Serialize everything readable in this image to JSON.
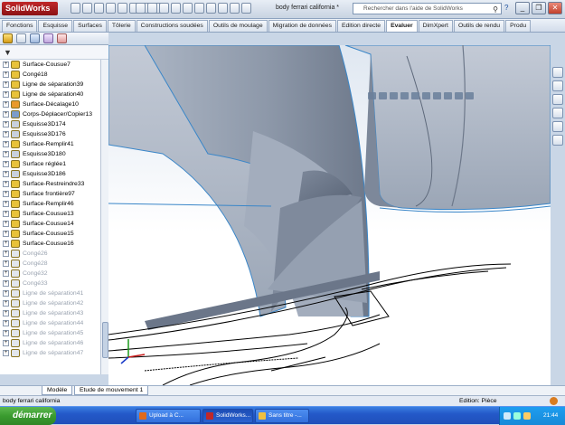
{
  "app": {
    "logo_text": "SolidWorks",
    "document_title": "body ferrari california *"
  },
  "help": {
    "search_placeholder": "Rechercher dans l'aide de SolidWorks",
    "search_icon": "magnifier-icon",
    "help_icon": "question-icon"
  },
  "window_controls": {
    "minimize": "_",
    "restore": "❐",
    "close": "✕"
  },
  "command_tabs": [
    "Fonctions",
    "Esquisse",
    "Surfaces",
    "Tôlerie",
    "Constructions soudées",
    "Outils de moulage",
    "Migration de données",
    "Edition directe",
    "Evaluer",
    "DimXpert",
    "Outils de rendu",
    "Produ"
  ],
  "active_tab": "Evaluer",
  "filter_icon": "funnel-icon",
  "tree": [
    {
      "label": "Surface-Cousue7",
      "icon": "surface-knit-icon",
      "color": "#e8c23a",
      "greyed": false
    },
    {
      "label": "Congé18",
      "icon": "fillet-icon",
      "color": "#e8c23a",
      "greyed": false
    },
    {
      "label": "Ligne de séparation39",
      "icon": "split-line-icon",
      "color": "#e8c23a",
      "greyed": false
    },
    {
      "label": "Ligne de séparation40",
      "icon": "split-line-icon",
      "color": "#e8c23a",
      "greyed": false
    },
    {
      "label": "Surface-Décalage10",
      "icon": "surface-offset-icon",
      "color": "#e89a2a",
      "greyed": false
    },
    {
      "label": "Corps-Déplacer/Copier13",
      "icon": "move-body-icon",
      "color": "#7c9cc8",
      "greyed": false
    },
    {
      "label": "Esquisse3D174",
      "icon": "sketch-icon",
      "color": "#c8d0dc",
      "greyed": false
    },
    {
      "label": "Esquisse3D176",
      "icon": "sketch-icon",
      "color": "#c8d0dc",
      "greyed": false
    },
    {
      "label": "Surface-Remplir41",
      "icon": "surface-fill-icon",
      "color": "#e8c23a",
      "greyed": false
    },
    {
      "label": "Esquisse3D180",
      "icon": "sketch-icon",
      "color": "#c8d0dc",
      "greyed": false
    },
    {
      "label": "Surface réglée1",
      "icon": "ruled-surface-icon",
      "color": "#e8c23a",
      "greyed": false
    },
    {
      "label": "Esquisse3D186",
      "icon": "sketch-icon",
      "color": "#c8d0dc",
      "greyed": false
    },
    {
      "label": "Surface-Restreindre33",
      "icon": "surface-trim-icon",
      "color": "#e8c23a",
      "greyed": false
    },
    {
      "label": "Surface frontière97",
      "icon": "boundary-surface-icon",
      "color": "#e8c23a",
      "greyed": false
    },
    {
      "label": "Surface-Remplir46",
      "icon": "surface-fill-icon",
      "color": "#e8c23a",
      "greyed": false
    },
    {
      "label": "Surface-Cousue13",
      "icon": "surface-knit-icon",
      "color": "#e8c23a",
      "greyed": false
    },
    {
      "label": "Surface-Cousue14",
      "icon": "surface-knit-icon",
      "color": "#e8c23a",
      "greyed": false
    },
    {
      "label": "Surface-Cousue15",
      "icon": "surface-knit-icon",
      "color": "#e8c23a",
      "greyed": false
    },
    {
      "label": "Surface-Cousue16",
      "icon": "surface-knit-icon",
      "color": "#e8c23a",
      "greyed": false
    },
    {
      "label": "Congé26",
      "icon": "fillet-icon",
      "color": "#e2e6ec",
      "greyed": true
    },
    {
      "label": "Congé28",
      "icon": "fillet-icon",
      "color": "#e2e6ec",
      "greyed": true
    },
    {
      "label": "Congé32",
      "icon": "fillet-icon",
      "color": "#e2e6ec",
      "greyed": true
    },
    {
      "label": "Congé33",
      "icon": "fillet-icon",
      "color": "#e2e6ec",
      "greyed": true
    },
    {
      "label": "Ligne de séparation41",
      "icon": "split-line-icon",
      "color": "#e2e6ec",
      "greyed": true
    },
    {
      "label": "Ligne de séparation42",
      "icon": "split-line-icon",
      "color": "#e2e6ec",
      "greyed": true
    },
    {
      "label": "Ligne de séparation43",
      "icon": "split-line-icon",
      "color": "#e2e6ec",
      "greyed": true
    },
    {
      "label": "Ligne de séparation44",
      "icon": "split-line-icon",
      "color": "#e2e6ec",
      "greyed": true
    },
    {
      "label": "Ligne de séparation45",
      "icon": "split-line-icon",
      "color": "#e2e6ec",
      "greyed": true
    },
    {
      "label": "Ligne de séparation46",
      "icon": "split-line-icon",
      "color": "#e2e6ec",
      "greyed": true
    },
    {
      "label": "Ligne de séparation47",
      "icon": "split-line-icon",
      "color": "#e2e6ec",
      "greyed": true
    }
  ],
  "bottom_tabs": {
    "model": "Modèle",
    "motion": "Etude de mouvement 1"
  },
  "status": {
    "left": "body ferrari california",
    "mode": "Edition: Pièce"
  },
  "taskbar": {
    "start": "démarrer",
    "tasks": [
      {
        "label": "Upload à C...",
        "icon": "firefox-icon",
        "color": "#e06a1c"
      },
      {
        "label": "SolidWorks...",
        "icon": "solidworks-icon",
        "color": "#c0282a"
      },
      {
        "label": "Sans titre -...",
        "icon": "paint-icon",
        "color": "#f0c040"
      }
    ],
    "clock": "21:44"
  },
  "colors": {
    "body_panel": "#8e9bae",
    "edge": "#3a86c8",
    "sketch_lines": "#000000"
  }
}
